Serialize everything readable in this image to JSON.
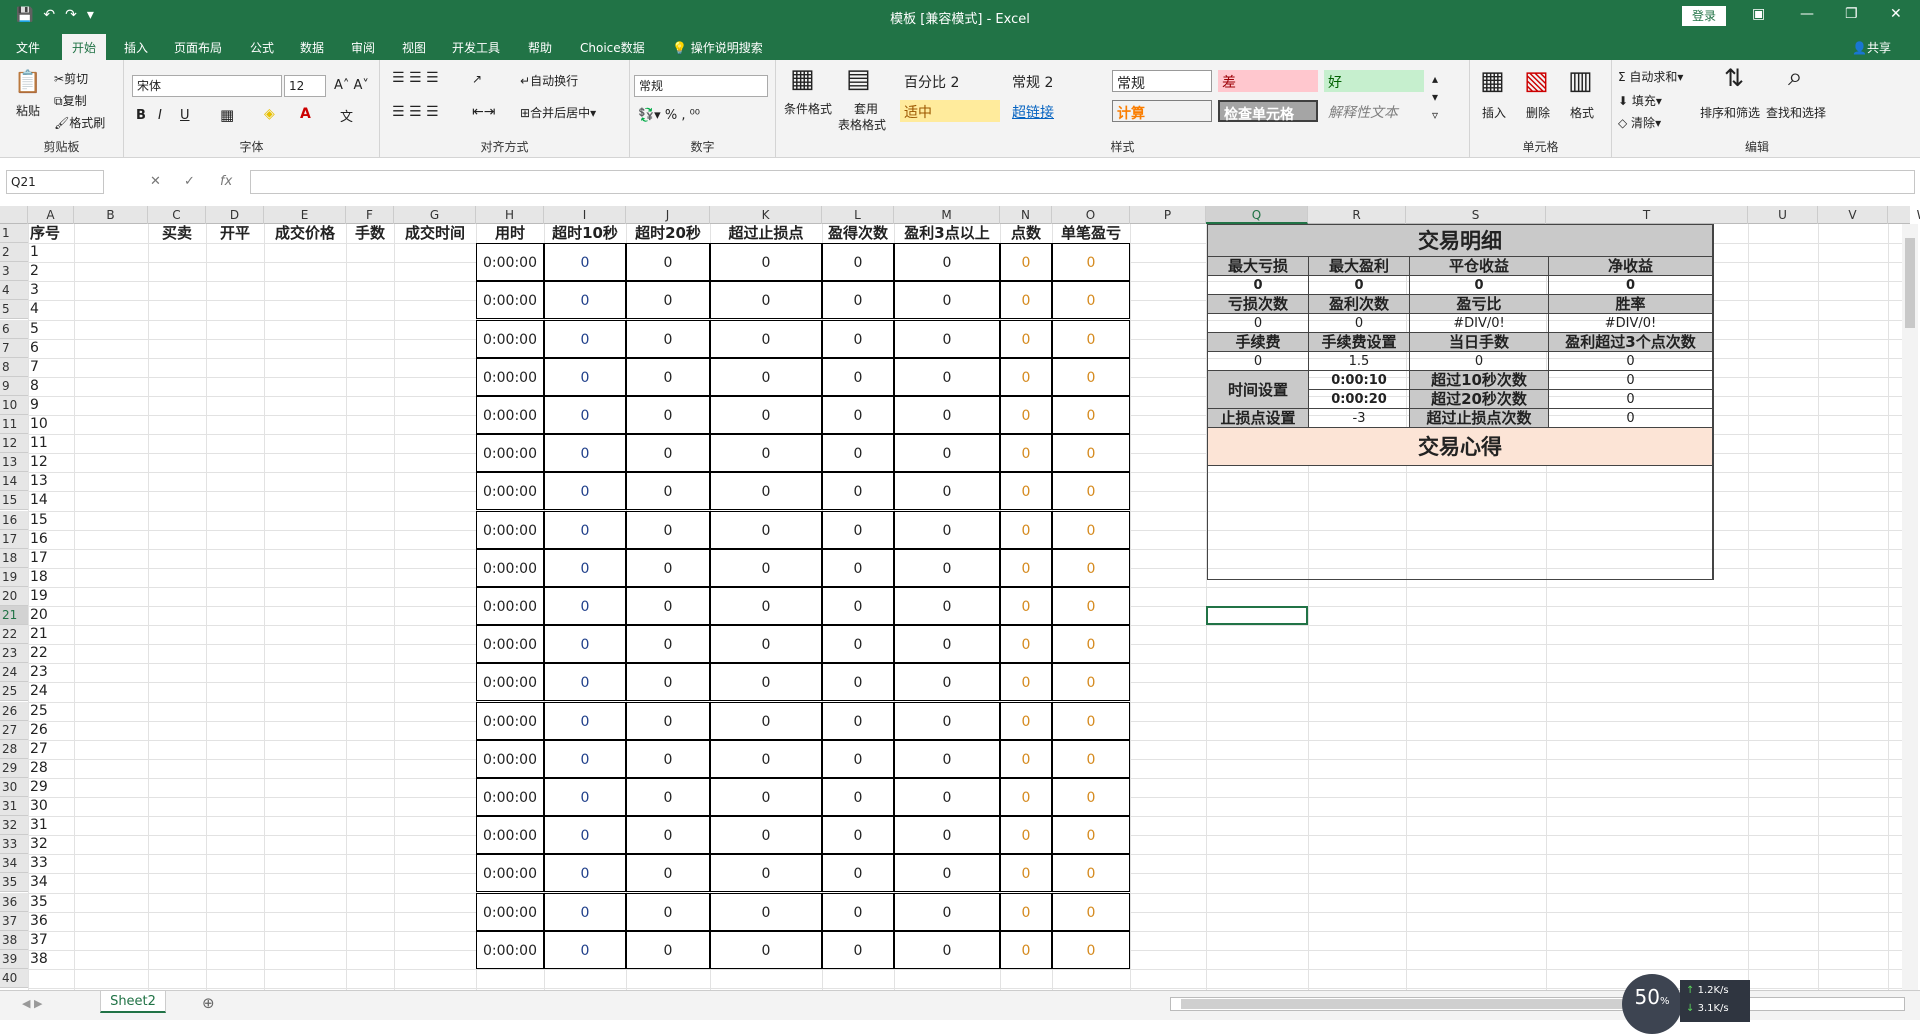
{
  "window": {
    "title": "模板 [兼容模式] - Excel",
    "login": "登录",
    "share": "共享"
  },
  "tabs": [
    "文件",
    "开始",
    "插入",
    "页面布局",
    "公式",
    "数据",
    "审阅",
    "视图",
    "开发工具",
    "帮助",
    "Choice数据",
    "操作说明搜索"
  ],
  "ribbon": {
    "clipboard": {
      "paste": "粘贴",
      "cut": "剪切",
      "copy": "复制",
      "format_painter": "格式刷",
      "label": "剪贴板"
    },
    "font": {
      "name": "宋体",
      "size": "12",
      "label": "字体"
    },
    "alignment": {
      "wrap": "自动换行",
      "merge": "合并后居中",
      "label": "对齐方式"
    },
    "number": {
      "format": "常规",
      "label": "数字"
    },
    "styles": {
      "cond": "条件格式",
      "table_line1": "套用",
      "table_line2": "表格格式",
      "items": [
        "百分比 2",
        "常规 2",
        "常规",
        "差",
        "好",
        "适中",
        "超链接",
        "计算",
        "检查单元格",
        "解释性文本"
      ],
      "label": "样式"
    },
    "cells": {
      "insert": "插入",
      "delete": "删除",
      "format": "格式",
      "label": "单元格"
    },
    "editing": {
      "autosum": "自动求和",
      "fill": "填充",
      "clear": "清除",
      "sort": "排序和筛选",
      "find": "查找和选择",
      "label": "编辑"
    }
  },
  "formula_bar": {
    "name_box": "Q21",
    "fx": "fx",
    "formula": ""
  },
  "columns": [
    "A",
    "B",
    "C",
    "D",
    "E",
    "F",
    "G",
    "H",
    "I",
    "J",
    "K",
    "L",
    "M",
    "N",
    "O",
    "P",
    "Q",
    "R",
    "S",
    "T",
    "U",
    "V",
    "W"
  ],
  "headers": [
    "序号",
    "",
    "买卖",
    "开平",
    "成交价格",
    "手数",
    "成交时间",
    "用时",
    "超时10秒",
    "超时20秒",
    "超过止损点",
    "盈得次数",
    "盈利3点以上",
    "点数",
    "单笔盈亏"
  ],
  "rows": [
    "1",
    "2",
    "3",
    "4",
    "5",
    "6",
    "7",
    "8",
    "9",
    "10",
    "11",
    "12",
    "13",
    "14",
    "15",
    "16",
    "17",
    "18",
    "19",
    "20",
    "21",
    "22",
    "23",
    "24",
    "25",
    "26",
    "27",
    "28",
    "29",
    "30",
    "31",
    "32",
    "33",
    "34",
    "35",
    "36",
    "37",
    "38",
    "39",
    "40"
  ],
  "time_value": "0:00:00",
  "zero": "0",
  "panel": {
    "title": "交易明细",
    "r1": [
      "最大亏损",
      "最大盈利",
      "平仓收益",
      "净收益"
    ],
    "r1v": [
      "0",
      "0",
      "0",
      "0"
    ],
    "r2": [
      "亏损次数",
      "盈利次数",
      "盈亏比",
      "胜率"
    ],
    "r2v": [
      "0",
      "0",
      "#DIV/0!",
      "#DIV/0!"
    ],
    "r3": [
      "手续费",
      "手续费设置",
      "当日手数",
      "盈利超过3个点次数"
    ],
    "r3v": [
      "0",
      "1.5",
      "0",
      "0"
    ],
    "time_label": "时间设置",
    "t1": "0:00:10",
    "t1l": "超过10秒次数",
    "t1v": "0",
    "t2": "0:00:20",
    "t2l": "超过20秒次数",
    "t2v": "0",
    "stop_label": "止损点设置",
    "stop": "-3",
    "stop_l": "超过止损点次数",
    "stop_v": "0",
    "notes": "交易心得"
  },
  "sheet_tab": "Sheet2",
  "speed": {
    "percent": "50",
    "pct_sign": "%",
    "up": "1.2",
    "down": "3.1",
    "unit": "K/s"
  }
}
